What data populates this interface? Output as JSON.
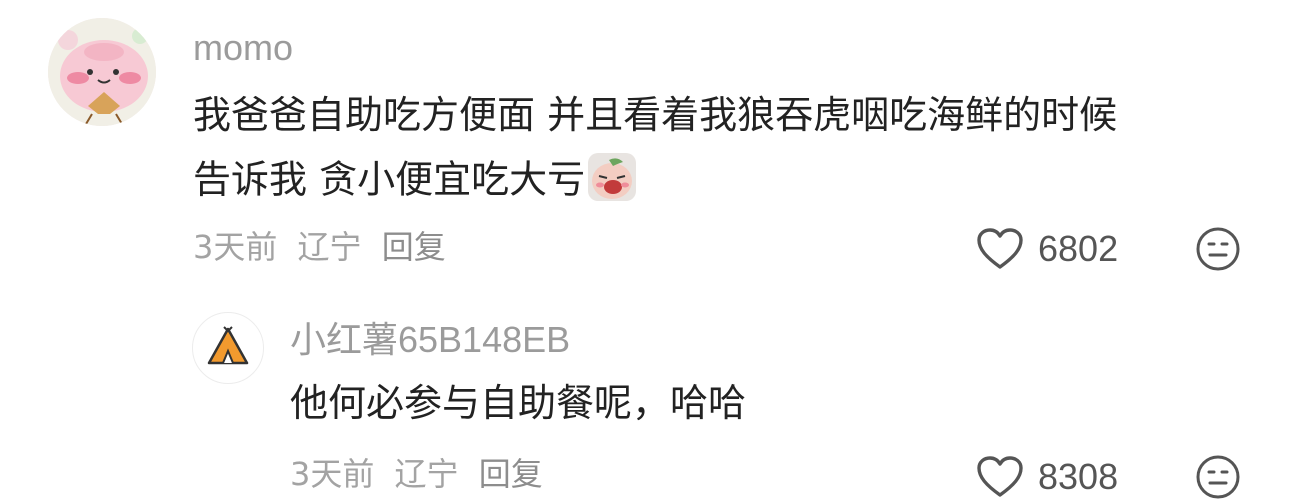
{
  "comment": {
    "username": "momo",
    "text_line1": "我爸爸自助吃方便面 并且看着我狼吞虎咽吃海鲜的时候",
    "text_line2": "告诉我 贪小便宜吃大亏",
    "emoji_icon": "crying-face-sticker",
    "meta_time": "3天前",
    "meta_location": "辽宁",
    "meta_reply": "回复",
    "likes": "6802"
  },
  "reply": {
    "username": "小红薯65B148EB",
    "text": "他何必参与自助餐呢，哈哈",
    "meta_time": "3天前",
    "meta_location": "辽宁",
    "meta_reply": "回复",
    "likes": "8308"
  },
  "icons": {
    "like": "heart-outline-icon",
    "emoji": "neutral-face-icon",
    "avatar_main": "pink-character-avatar",
    "avatar_reply": "tent-avatar"
  }
}
